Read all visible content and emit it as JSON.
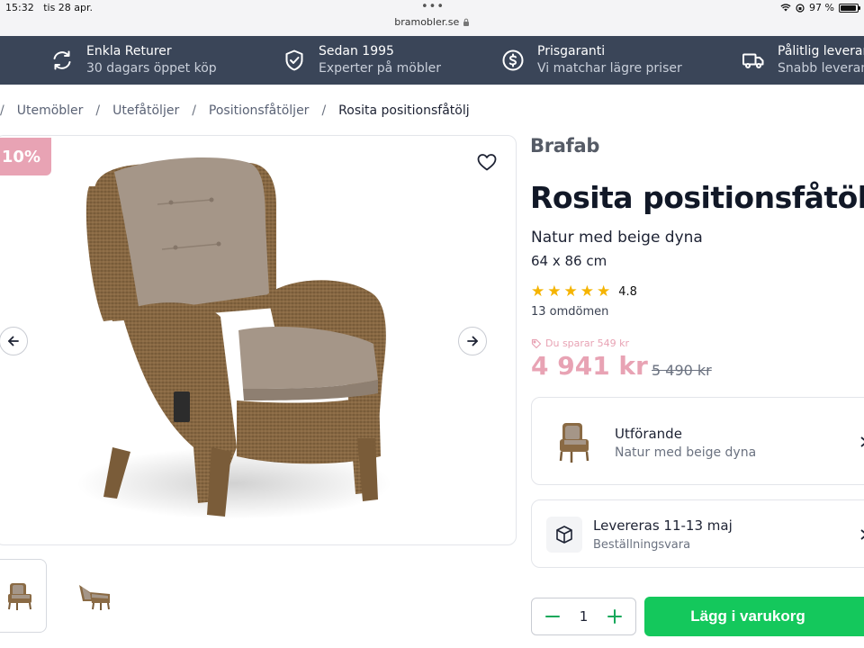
{
  "status_bar": {
    "time": "15:32",
    "date": "tis 28 apr.",
    "dots": "•••",
    "url": "bramobler.se",
    "battery_percent": "97 %",
    "battery_level": 0.97
  },
  "usp": [
    {
      "title": "Enkla Returer",
      "subtitle": "30 dagars öppet köp",
      "icon": "refresh-icon"
    },
    {
      "title": "Sedan 1995",
      "subtitle": "Experter på möbler",
      "icon": "shield-check-icon"
    },
    {
      "title": "Prisgaranti",
      "subtitle": "Vi matchar lägre priser",
      "icon": "dollar-circle-icon"
    },
    {
      "title": "Pålitlig leveran",
      "subtitle": "Snabb leveran",
      "icon": "truck-icon"
    }
  ],
  "breadcrumb": {
    "separator": "/",
    "items": [
      "Utemöbler",
      "Utefåtöljer",
      "Positionsfåtöljer"
    ],
    "current": "Rosita positionsfåtölj"
  },
  "gallery": {
    "discount": "10%",
    "thumbnails": 2
  },
  "product": {
    "brand": "Brafab",
    "title": "Rosita positionsfåtölj",
    "variant": "Natur med beige dyna",
    "size": "64 x 86 cm",
    "rating": "4.8",
    "stars": 5,
    "reviews": "13 omdömen",
    "saving": "Du sparar 549 kr",
    "price": "4 941 kr",
    "old_price": "5 490 kr"
  },
  "options": {
    "variant_title": "Utförande",
    "variant_value": "Natur med beige dyna",
    "delivery_title": "Levereras 11-13 maj",
    "delivery_sub": "Beställningsvara"
  },
  "cart": {
    "quantity": "1",
    "button_label": "Lägg i varukorg"
  },
  "colors": {
    "usp_bg": "#3a4558",
    "price_pink": "#e8a3b4",
    "cart_green": "#14c85c",
    "star": "#f5b400"
  }
}
